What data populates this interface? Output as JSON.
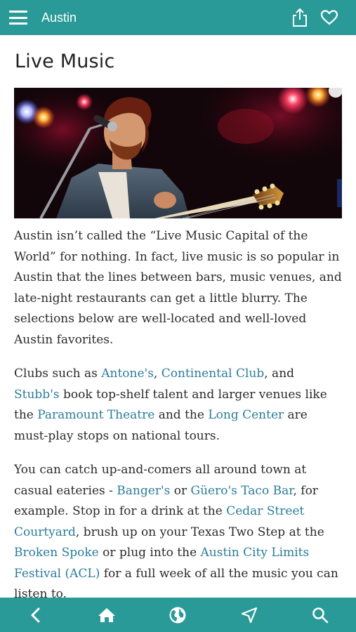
{
  "header": {
    "title": "Austin",
    "menu_icon": "hamburger-menu-icon",
    "share_icon": "share-icon",
    "favorite_icon": "heart-icon"
  },
  "page": {
    "heading": "Live Music"
  },
  "hero_image": {
    "subject": "musician-singing-with-guitar"
  },
  "paragraphs": {
    "p1": "Austin isn’t called the “Live Music Capital of the World” for nothing. In fact, live music is so popular in Austin that the lines between bars, music venues, and late-night restaurants can get a little blurry. The selections below are well-located and well-loved Austin favorites.",
    "p2": {
      "t1": "Clubs such as ",
      "l1": "Antone's",
      "t2": ", ",
      "l2": "Continental Club",
      "t3": ", and ",
      "l3": "Stubb's",
      "t4": " book top-shelf talent and larger venues like the ",
      "l4": "Paramount Theatre",
      "t5": " and the ",
      "l5": "Long Center",
      "t6": " are must-play stops on national tours."
    },
    "p3": {
      "t1": "You can catch up-and-comers all around town at casual eateries - ",
      "l1": "Banger's",
      "t2": " or ",
      "l2": "Güero's Taco Bar",
      "t3": ", for example. Stop in for a drink at the ",
      "l3": "Cedar Street Courtyard",
      "t4": ", brush up on your Texas Two Step at the ",
      "l4": "Broken Spoke",
      "t5": " or plug into the ",
      "l5": "Austin City Limits Festival (ACL)",
      "t6": " for a full week of all the music you can listen to."
    }
  },
  "bottom_nav": [
    "back-icon",
    "home-icon",
    "globe-icon",
    "navigate-icon",
    "search-icon"
  ],
  "colors": {
    "bar": "#2a9a98",
    "link": "#2a7c9a",
    "text": "#2b2b2b"
  }
}
